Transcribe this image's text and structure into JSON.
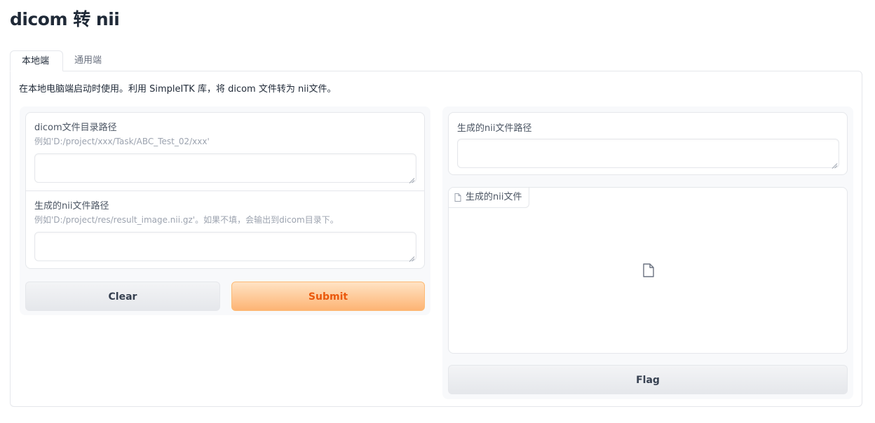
{
  "app": {
    "title": "dicom 转 nii"
  },
  "tabs": [
    {
      "label": "本地端",
      "active": true
    },
    {
      "label": "通用端",
      "active": false
    }
  ],
  "panel": {
    "description": "在本地电脑端启动时使用。利用 SimpleITK 库，将 dicom 文件转为 nii文件。"
  },
  "inputs": {
    "dicom_dir": {
      "label": "dicom文件目录路径",
      "info": "例如'D:/project/xxx/Task/ABC_Test_02/xxx'",
      "value": ""
    },
    "nii_path": {
      "label": "生成的nii文件路径",
      "info": "例如'D:/project/res/result_image.nii.gz'。如果不填，会输出到dicom目录下。",
      "value": ""
    }
  },
  "buttons": {
    "clear": "Clear",
    "submit": "Submit",
    "flag": "Flag"
  },
  "outputs": {
    "nii_path": {
      "label": "生成的nii文件路径",
      "value": ""
    },
    "nii_file": {
      "label": "生成的nii文件",
      "icon": "file-icon"
    }
  },
  "colors": {
    "accent": "#ea580c",
    "submit_bg_top": "#ffe3c4",
    "submit_bg_bottom": "#fdb474",
    "border": "#e5e7eb"
  }
}
